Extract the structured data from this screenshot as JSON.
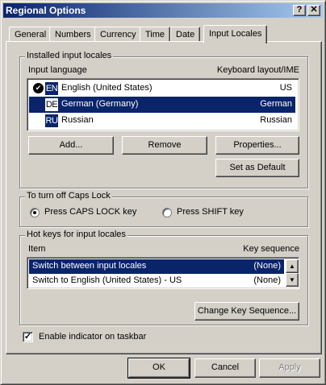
{
  "window": {
    "title": "Regional Options",
    "help_label": "?",
    "close_label": "✕"
  },
  "tabs": [
    "General",
    "Numbers",
    "Currency",
    "Time",
    "Date",
    "Input Locales"
  ],
  "installed": {
    "group_label": "Installed input locales",
    "col_language": "Input language",
    "col_layout": "Keyboard layout/IME",
    "rows": [
      {
        "code": "EN",
        "language": "English (United States)",
        "layout": "US",
        "default": true
      },
      {
        "code": "DE",
        "language": "German (Germany)",
        "layout": "German"
      },
      {
        "code": "RU",
        "language": "Russian",
        "layout": "Russian"
      }
    ],
    "add_label": "Add...",
    "remove_label": "Remove",
    "properties_label": "Properties...",
    "set_default_label": "Set as Default"
  },
  "caps": {
    "group_label": "To turn off Caps Lock",
    "opt_caps": "Press CAPS LOCK key",
    "opt_shift": "Press SHIFT key"
  },
  "hotkeys": {
    "group_label": "Hot keys for input locales",
    "col_item": "Item",
    "col_seq": "Key sequence",
    "rows": [
      {
        "item": "Switch between input locales",
        "seq": "(None)"
      },
      {
        "item": "Switch to English (United States) - US",
        "seq": "(None)"
      }
    ],
    "change_label": "Change Key Sequence..."
  },
  "indicator_label": "Enable indicator on taskbar",
  "footer": {
    "ok": "OK",
    "cancel": "Cancel",
    "apply": "Apply"
  }
}
